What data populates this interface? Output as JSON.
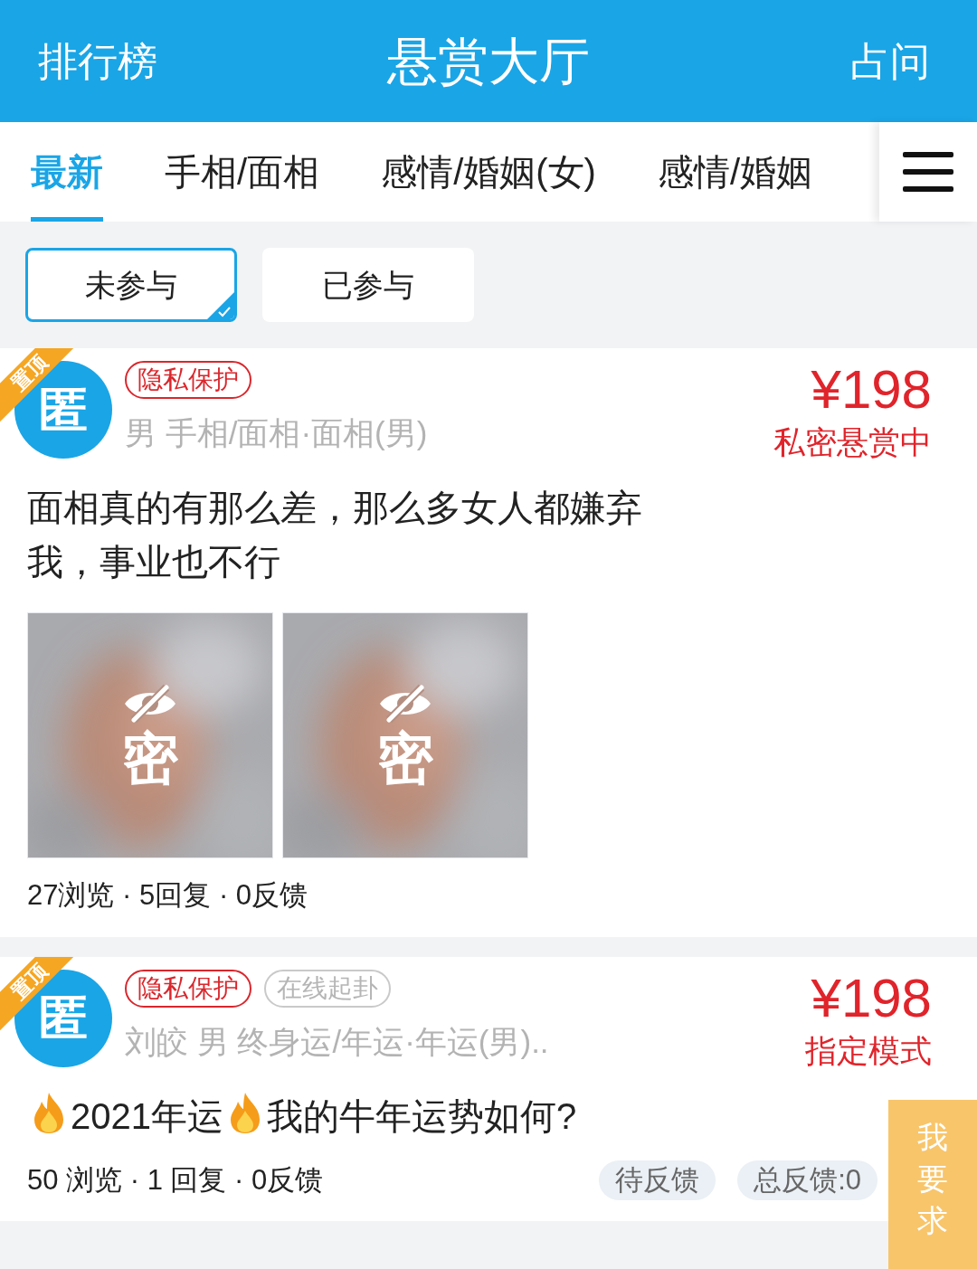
{
  "header": {
    "left": "排行榜",
    "title": "悬赏大厅",
    "right": "占问"
  },
  "tabs": [
    {
      "label": "最新",
      "selected": true
    },
    {
      "label": "手相/面相",
      "selected": false
    },
    {
      "label": "感情/婚姻(女)",
      "selected": false
    },
    {
      "label": "感情/婚姻",
      "selected": false
    }
  ],
  "filters": [
    {
      "label": "未参与",
      "selected": true
    },
    {
      "label": "已参与",
      "selected": false
    }
  ],
  "posts": [
    {
      "pinned": true,
      "pin_label": "置顶",
      "avatar": "匿",
      "tags": [
        {
          "text": "隐私保护",
          "kind": "red"
        }
      ],
      "meta": "男 手相/面相·面相(男)",
      "price": "¥198",
      "mode": "私密悬赏中",
      "title_segments": [
        {
          "kind": "text",
          "text": "面相真的有那么差，那么多女人都嫌弃我，事业也不行"
        }
      ],
      "images": [
        {
          "kind": "picture",
          "label": "密"
        },
        {
          "kind": "picture",
          "label": "密"
        }
      ],
      "stats": "27浏览 · 5回复 · 0反馈"
    },
    {
      "pinned": true,
      "pin_label": "置顶",
      "avatar": "匿",
      "tags": [
        {
          "text": "隐私保护",
          "kind": "red"
        },
        {
          "text": "在线起卦",
          "kind": "gray"
        }
      ],
      "meta": "刘皎 男 终身运/年运·年运(男)..",
      "price": "¥198",
      "mode": "指定模式",
      "title_segments": [
        {
          "kind": "flame"
        },
        {
          "kind": "text",
          "text": "2021年运"
        },
        {
          "kind": "flame"
        },
        {
          "kind": "text",
          "text": "我的牛年运势如何?"
        }
      ],
      "stats": "50 浏览 · 1 回复 · 0反馈",
      "chips": [
        "待反馈",
        "总反馈:0"
      ]
    }
  ],
  "float_button": {
    "chars": [
      "我",
      "要",
      "求"
    ]
  }
}
